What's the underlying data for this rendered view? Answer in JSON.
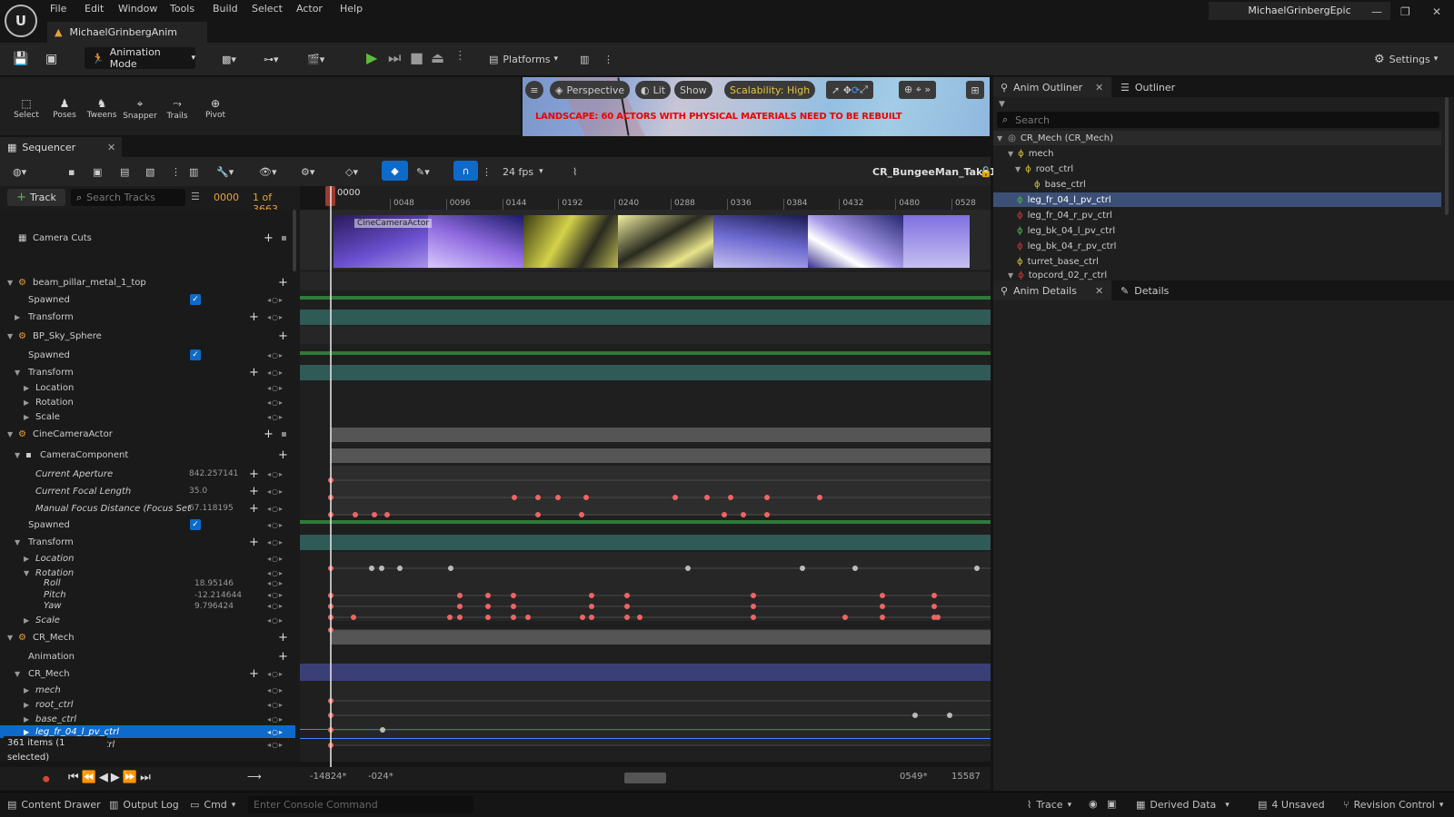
{
  "app": {
    "logo_text": "U",
    "project_tab": "MichaelGrinbergAnim",
    "account": "MichaelGrinbergEpic"
  },
  "menu": [
    "File",
    "Edit",
    "Window",
    "Tools",
    "Build",
    "Select",
    "Actor",
    "Help"
  ],
  "toolbar": {
    "mode": "Animation Mode",
    "platforms": "Platforms",
    "settings": "Settings"
  },
  "mode_tools": [
    "Select",
    "Poses",
    "Tweens",
    "Snapper",
    "Trails",
    "Pivot"
  ],
  "viewport": {
    "perspective": "Perspective",
    "lit": "Lit",
    "show": "Show",
    "scalability": "Scalability: High",
    "warning": "LANDSCAPE: 60 ACTORS WITH PHYSICAL MATERIALS NEED TO BE REBUILT"
  },
  "sequencer": {
    "tab": "Sequencer",
    "fps": "24 fps",
    "sequence_name": "CR_BungeeMan_Take1",
    "track_button": "Track",
    "search_placeholder": "Search Tracks",
    "current_frame": "0000",
    "frame_count": "1 of 3663",
    "ruler_start": "0000",
    "ruler_ticks": [
      "0048",
      "0096",
      "0144",
      "0192",
      "0240",
      "0288",
      "0336",
      "0384",
      "0432",
      "0480",
      "0528"
    ],
    "thumb_label": "CineCameraActor",
    "items_status": "361 items (1 selected)",
    "range": {
      "start_out": "-14824*",
      "start_in": "-024*",
      "end_in": "0549*",
      "end_out": "15587"
    }
  },
  "tracks": [
    {
      "label": "Camera Cuts"
    },
    {
      "label": "beam_pillar_metal_1_top"
    },
    {
      "label": "Spawned"
    },
    {
      "label": "Transform"
    },
    {
      "label": "BP_Sky_Sphere"
    },
    {
      "label": "Spawned"
    },
    {
      "label": "Transform"
    },
    {
      "label": "Location"
    },
    {
      "label": "Rotation"
    },
    {
      "label": "Scale"
    },
    {
      "label": "CineCameraActor"
    },
    {
      "label": "CameraComponent"
    },
    {
      "label": "Current Aperture",
      "value": "842.257141"
    },
    {
      "label": "Current Focal Length",
      "value": "35.0"
    },
    {
      "label": "Manual Focus Distance (Focus Set",
      "value": "67.118195"
    },
    {
      "label": "Spawned"
    },
    {
      "label": "Transform"
    },
    {
      "label": "Location"
    },
    {
      "label": "Rotation"
    },
    {
      "label": "Roll",
      "value": "18.95146"
    },
    {
      "label": "Pitch",
      "value": "-12.214644"
    },
    {
      "label": "Yaw",
      "value": "9.796424"
    },
    {
      "label": "Scale"
    },
    {
      "label": "CR_Mech"
    },
    {
      "label": "Animation"
    },
    {
      "label": "CR_Mech"
    },
    {
      "label": "mech"
    },
    {
      "label": "root_ctrl"
    },
    {
      "label": "base_ctrl"
    },
    {
      "label": "leg_fr_04_l_pv_ctrl"
    },
    {
      "label": "ctrl"
    }
  ],
  "anim_outliner": {
    "tab": "Anim Outliner",
    "outliner_tab": "Outliner",
    "search_placeholder": "Search",
    "items": [
      "CR_Mech (CR_Mech)",
      "mech",
      "root_ctrl",
      "base_ctrl",
      "leg_fr_04_l_pv_ctrl",
      "leg_fr_04_r_pv_ctrl",
      "leg_bk_04_l_pv_ctrl",
      "leg_bk_04_r_pv_ctrl",
      "turret_base_ctrl",
      "topcord_02_r_ctrl"
    ]
  },
  "anim_details": {
    "tab": "Anim Details",
    "details_tab": "Details"
  },
  "statusbar": {
    "content_drawer": "Content Drawer",
    "output_log": "Output Log",
    "cmd": "Cmd",
    "console_placeholder": "Enter Console Command",
    "trace": "Trace",
    "derived_data": "Derived Data",
    "unsaved": "4 Unsaved",
    "revision": "Revision Control"
  },
  "colors": {
    "accent": "#0d6acb",
    "key": "#f06464",
    "warning": "#e7a13d",
    "selection": "#3c4f77"
  }
}
